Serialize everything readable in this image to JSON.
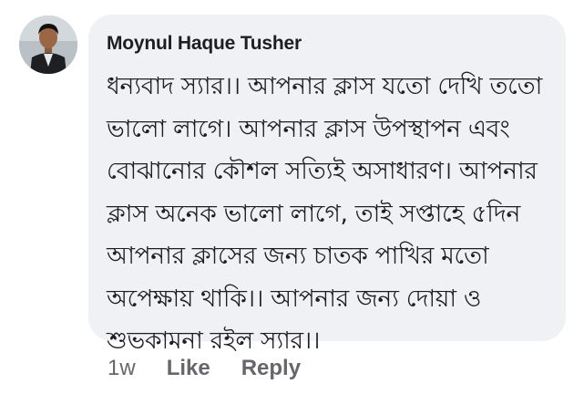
{
  "comment": {
    "author": "Moynul Haque Tusher",
    "text": "ধন্যবাদ স্যার।। আপনার ক্লাস যতো দেখি ততো\nভালো লাগে। আপনার ক্লাস উপস্থাপন এবং\nবোঝানোর কৌশল সত্যিই অসাধারণ। আপনার\nক্লাস অনেক ভালো লাগে, তাই সপ্তাহে ৫দিন\nআপনার ক্লাসের জন্য চাতক পাখির মতো\nঅপেক্ষায় থাকি।। আপনার জন্য দোয়া ও\nশুভকামনা রইল স্যার।।",
    "timestamp": "1w",
    "like_label": "Like",
    "reply_label": "Reply"
  }
}
